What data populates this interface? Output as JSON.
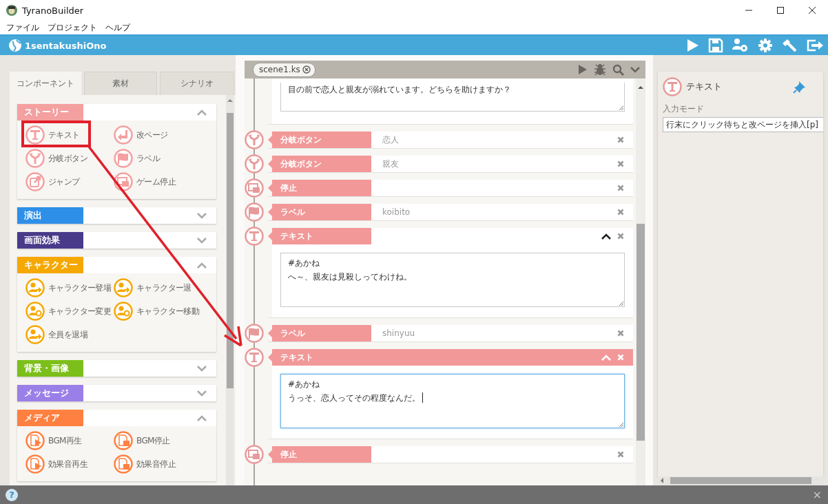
{
  "window": {
    "title": "TyranoBuilder"
  },
  "menu": [
    {
      "label": "ファイル"
    },
    {
      "label": "プロジェクト"
    },
    {
      "label": "ヘルプ"
    }
  ],
  "project": {
    "name": "1sentakushiOno"
  },
  "left_panel": {
    "tabs": [
      {
        "label": "コンポーネント",
        "selected": true
      },
      {
        "label": "素材",
        "selected": false
      },
      {
        "label": "シナリオ",
        "selected": false
      }
    ],
    "sections": [
      {
        "title": "ストーリー",
        "color": "#f4a0a0",
        "expanded": true,
        "items": [
          {
            "label": "テキスト",
            "kind": "text"
          },
          {
            "label": "改ページ",
            "kind": "page"
          },
          {
            "label": "分岐ボタン",
            "kind": "branch"
          },
          {
            "label": "ラベル",
            "kind": "label"
          },
          {
            "label": "ジャンプ",
            "kind": "jump"
          },
          {
            "label": "ゲーム停止",
            "kind": "stop"
          }
        ]
      },
      {
        "title": "演出",
        "color": "#2e8fe8",
        "expanded": false
      },
      {
        "title": "画面効果",
        "color": "#4a3a8a",
        "expanded": false
      },
      {
        "title": "キャラクター",
        "color": "#f5a800",
        "expanded": true,
        "items": [
          {
            "label": "キャラクター登場",
            "kind": "char_in"
          },
          {
            "label": "キャラクター退",
            "kind": "char_out"
          },
          {
            "label": "キャラクター変更",
            "kind": "char_change"
          },
          {
            "label": "キャラクター移動",
            "kind": "char_move"
          },
          {
            "label": "全員を退場",
            "kind": "char_out"
          }
        ]
      },
      {
        "title": "背景・画像",
        "color": "#7cbf1a",
        "expanded": false
      },
      {
        "title": "メッセージ",
        "color": "#9b7fe8",
        "expanded": false
      },
      {
        "title": "メディア",
        "color": "#ff8040",
        "expanded": true,
        "items": [
          {
            "label": "BGM再生",
            "kind": "bgm_play"
          },
          {
            "label": "BGM停止",
            "kind": "bgm_stop"
          },
          {
            "label": "効果音再生",
            "kind": "se_play"
          },
          {
            "label": "効果音停止",
            "kind": "se_stop"
          }
        ]
      }
    ]
  },
  "scene": {
    "tab": "scene1.ks",
    "cut_text": "目の前で恋人と親友が溺れています。どちらを助けますか？",
    "items": [
      {
        "kind": "branch",
        "label": "分岐ボタン",
        "value": "恋人",
        "expanded": false,
        "selected": false
      },
      {
        "kind": "branch",
        "label": "分岐ボタン",
        "value": "親友",
        "expanded": false,
        "selected": false
      },
      {
        "kind": "stop",
        "label": "停止",
        "expanded": false,
        "selected": false
      },
      {
        "kind": "label",
        "label": "ラベル",
        "value": "koibito",
        "expanded": false,
        "selected": false
      },
      {
        "kind": "text",
        "label": "テキスト",
        "expanded": true,
        "selected": false,
        "lines": [
          "#あかね",
          "へ～、親友は見殺しってわけね。"
        ]
      },
      {
        "kind": "label",
        "label": "ラベル",
        "value": "shinyuu",
        "expanded": false,
        "selected": false
      },
      {
        "kind": "text",
        "label": "テキスト",
        "expanded": true,
        "selected": true,
        "lines": [
          "#あかね",
          "うっそ、恋人ってその程度なんだ。"
        ]
      },
      {
        "kind": "stop",
        "label": "停止",
        "expanded": false,
        "selected": false
      }
    ]
  },
  "inspector": {
    "title": "テキスト",
    "field_label": "入力モード",
    "field_value": "行末にクリック待ちと改ページを挿入[p]"
  },
  "status_bar": {
    "help": "?",
    "close": "×"
  },
  "annotation": {
    "kind": "box_with_arrow"
  }
}
